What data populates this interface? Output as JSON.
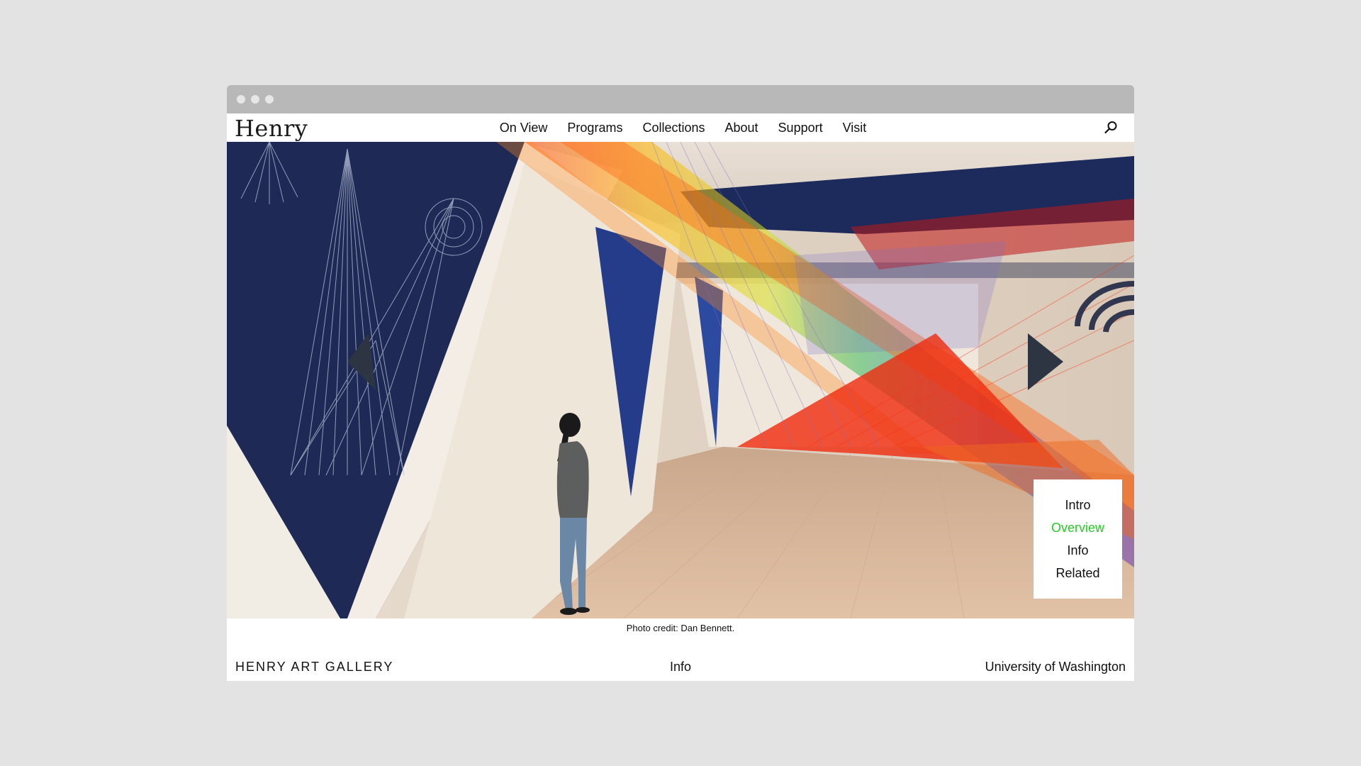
{
  "header": {
    "logo": "Henry",
    "nav": [
      "On View",
      "Programs",
      "Collections",
      "About",
      "Support",
      "Visit"
    ],
    "search_icon": "search-icon"
  },
  "hero": {
    "side_menu": {
      "items": [
        "Intro",
        "Overview",
        "Info",
        "Related"
      ],
      "active": "Overview",
      "active_color": "#22cc22"
    }
  },
  "caption": "Photo credit: Dan Bennett.",
  "footer": {
    "left": "HENRY ART GALLERY",
    "center": "Info",
    "right": "University of Washington"
  },
  "colors": {
    "page_background": "#e3e3e3",
    "chrome_bar": "#b8b8b8",
    "accent": "#22cc22"
  }
}
